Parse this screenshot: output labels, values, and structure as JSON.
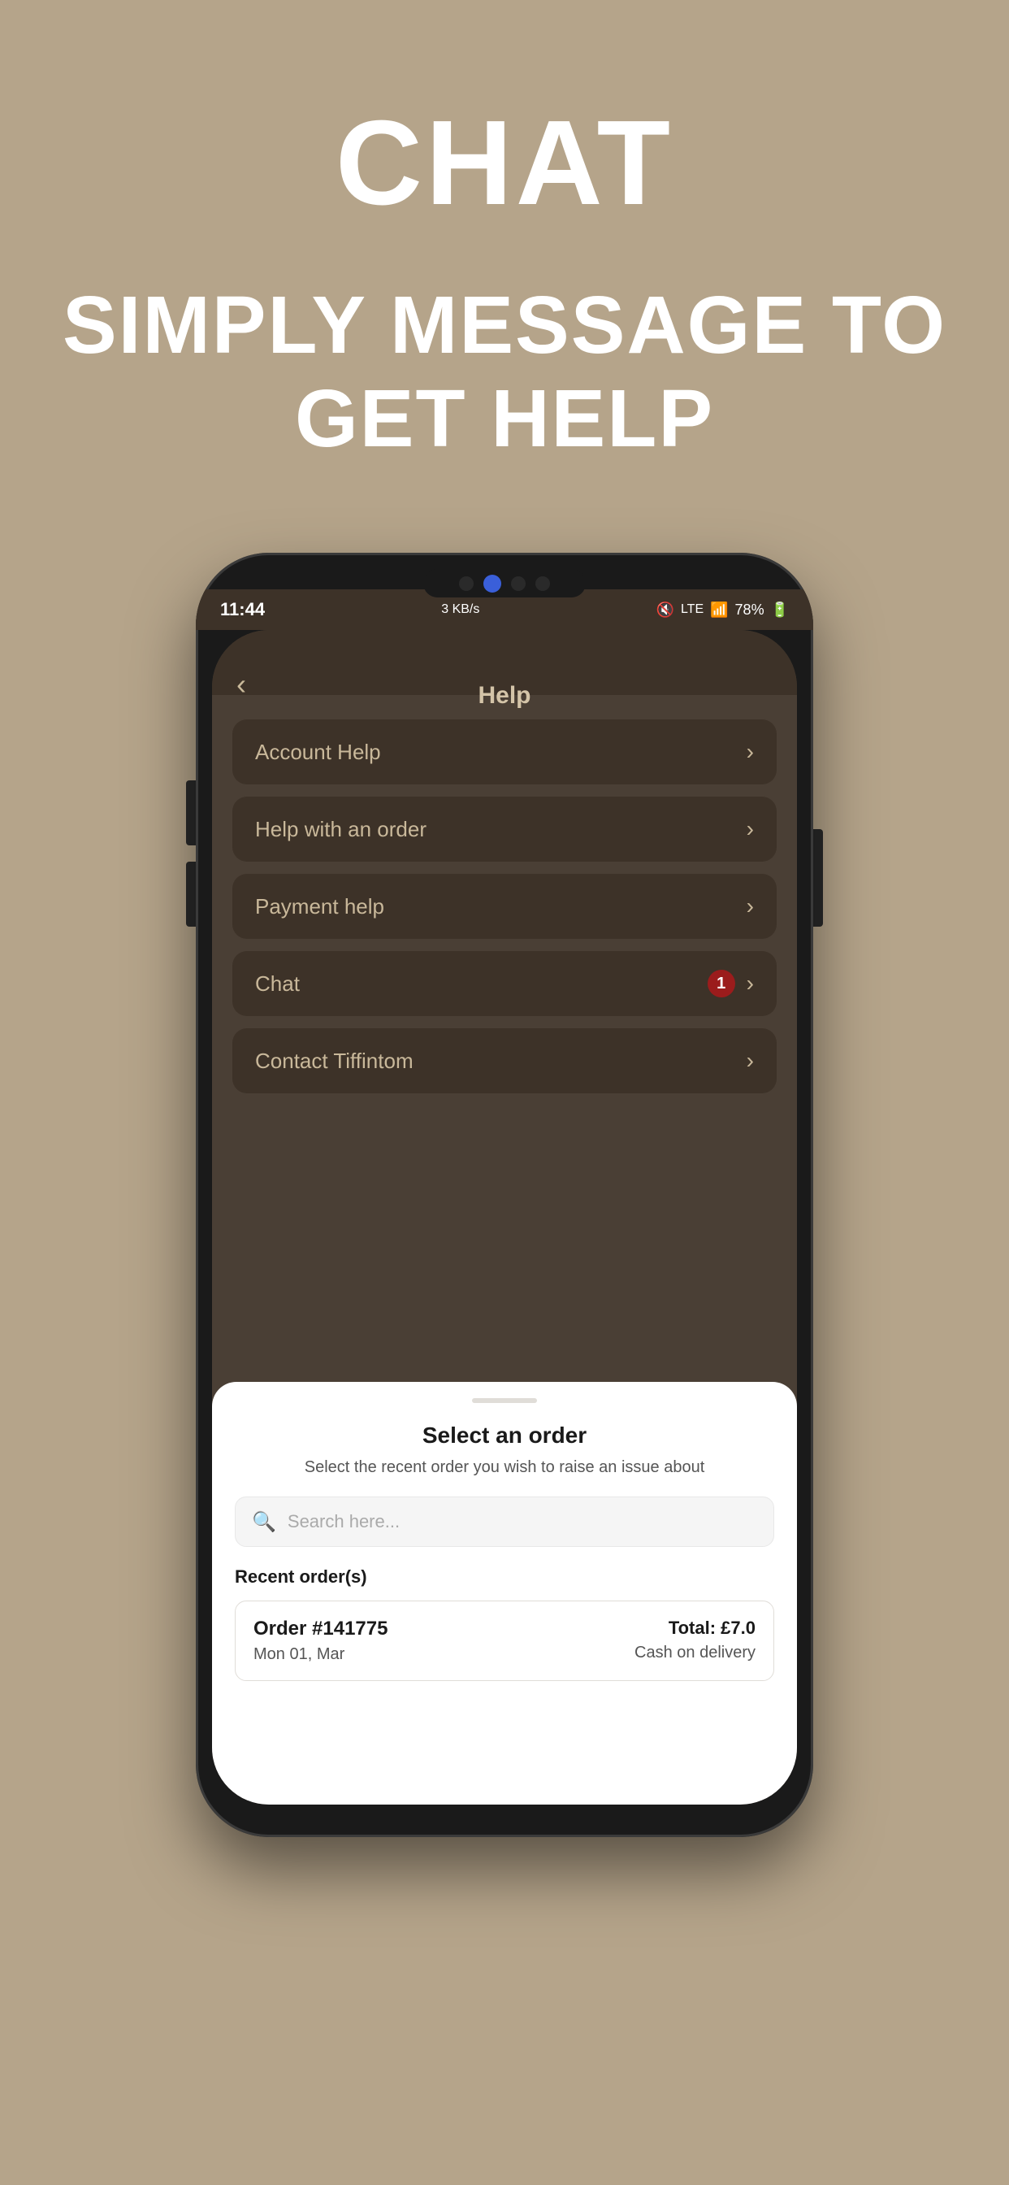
{
  "page": {
    "background_color": "#b5a48a",
    "title": "CHAT",
    "subtitle": "SIMPLY MESSAGE TO GET HELP"
  },
  "status_bar": {
    "time": "11:44",
    "data_speed": "3 KB/s",
    "battery": "78%",
    "signal": "LTE"
  },
  "app_header": {
    "title": "Help",
    "back_label": "‹"
  },
  "menu_items": [
    {
      "label": "Account Help",
      "badge": null,
      "id": "account-help"
    },
    {
      "label": "Help with an order",
      "badge": null,
      "id": "help-order"
    },
    {
      "label": "Payment help",
      "badge": null,
      "id": "payment-help"
    },
    {
      "label": "Chat",
      "badge": "1",
      "id": "chat"
    },
    {
      "label": "Contact Tiffintom",
      "badge": null,
      "id": "contact"
    }
  ],
  "bottom_sheet": {
    "title": "Select an order",
    "subtitle": "Select the recent order you wish to raise an issue about",
    "search_placeholder": "Search here...",
    "recent_orders_label": "Recent order(s)",
    "orders": [
      {
        "id": "Order #141775",
        "date": "Mon 01, Mar",
        "total": "Total: £7.0",
        "payment": "Cash on delivery"
      }
    ]
  }
}
